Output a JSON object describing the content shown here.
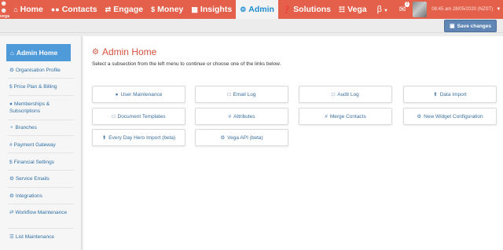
{
  "brand": {
    "logo_text": "vega",
    "accent": "#e5604a",
    "active_blue": "#4f9ad8"
  },
  "nav": {
    "items": [
      {
        "label": "Home",
        "icon": "home-icon"
      },
      {
        "label": "Contacts",
        "icon": "users-icon"
      },
      {
        "label": "Engage",
        "icon": "exchange-icon"
      },
      {
        "label": "Money",
        "icon": "dollar-icon"
      },
      {
        "label": "Insights",
        "icon": "bar-chart-icon"
      },
      {
        "label": "Admin",
        "icon": "cogs-icon",
        "active": true
      },
      {
        "label": "Solutions",
        "icon": "question-circle-icon"
      },
      {
        "label": "Vega",
        "icon": "lock-icon"
      }
    ],
    "beta_label": "β",
    "inbox_count": "2",
    "datetime": "08:45 am 28/05/2020 (NZST)"
  },
  "toolbar": {
    "save_label": "Save changes"
  },
  "sidebar": {
    "active_label": "Admin Home",
    "items": [
      {
        "label": "Organisation Profile",
        "icon": "settings-icon"
      },
      {
        "label": "Price Plan & Billing",
        "icon": "dollar-icon"
      },
      {
        "label": "Memberships & Subscriptions",
        "icon": "users-icon"
      },
      {
        "label": "Branches",
        "icon": "branch-icon"
      },
      {
        "label": "Payment Gateway",
        "icon": "hash-icon"
      },
      {
        "label": "Financial Settings",
        "icon": "dollar-icon"
      },
      {
        "label": "Service Emails",
        "icon": "settings-icon"
      },
      {
        "label": "Integrations",
        "icon": "integrations-icon"
      },
      {
        "label": "Workflow Maintenance",
        "icon": "exchange-icon"
      },
      {
        "label": "List Maintenance",
        "icon": "list-icon"
      }
    ]
  },
  "main": {
    "title": "Admin Home",
    "subtitle": "Select a subsection from the left menu to continue or choose one of the links below.",
    "tiles": [
      {
        "label": "User Maintenance",
        "icon": "users-icon"
      },
      {
        "label": "Email Log",
        "icon": "document-icon"
      },
      {
        "label": "Audit Log",
        "icon": "document-icon"
      },
      {
        "label": "Data Import",
        "icon": "upload-icon"
      },
      {
        "label": "Document Templates",
        "icon": "document-icon"
      },
      {
        "label": "Attributes",
        "icon": "hash-icon"
      },
      {
        "label": "Merge Contacts",
        "icon": "hash-icon"
      },
      {
        "label": "New Widget Configuration",
        "icon": "cogs-icon"
      },
      {
        "label": "Every Day Hero Import (beta)",
        "icon": "upload-icon"
      },
      {
        "label": "Vega API (beta)",
        "icon": "cogs-icon"
      }
    ]
  }
}
